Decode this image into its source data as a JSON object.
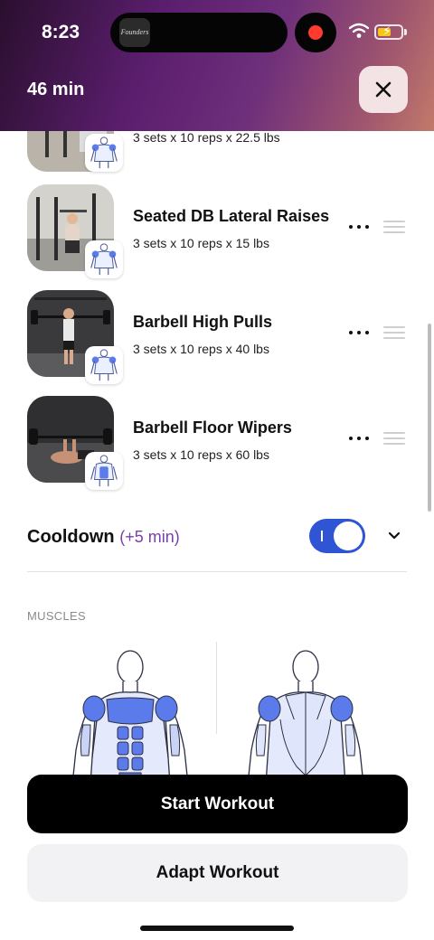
{
  "status_bar": {
    "time": "8:23",
    "island_app_label": "Founders",
    "recording_indicator": "record-dot",
    "wifi_icon": "wifi-icon",
    "battery_icon": "battery-charging-icon"
  },
  "header": {
    "duration": "46 min",
    "close_icon": "close-icon",
    "gradient_colors": [
      "#2a0f2e",
      "#5b1e6e",
      "#a0566e",
      "#c27a6a"
    ]
  },
  "exercises": [
    {
      "name": "",
      "detail": "3 sets x 10 reps x 22.5 lbs",
      "muscle_highlight": "shoulders"
    },
    {
      "name": "Seated DB Lateral Raises",
      "detail": "3 sets x 10 reps x 15 lbs",
      "muscle_highlight": "shoulders"
    },
    {
      "name": "Barbell High Pulls",
      "detail": "3 sets x 10 reps x 40 lbs",
      "muscle_highlight": "shoulders"
    },
    {
      "name": "Barbell Floor Wipers",
      "detail": "3 sets x 10 reps x 60 lbs",
      "muscle_highlight": "abs"
    }
  ],
  "cooldown": {
    "label": "Cooldown",
    "extra": "(+5 min)",
    "enabled": true,
    "accent_color": "#2f55d4"
  },
  "muscles": {
    "section_label": "MUSCLES",
    "highlight_color": "#5b7bea"
  },
  "actions": {
    "start_label": "Start Workout",
    "adapt_label": "Adapt Workout"
  }
}
